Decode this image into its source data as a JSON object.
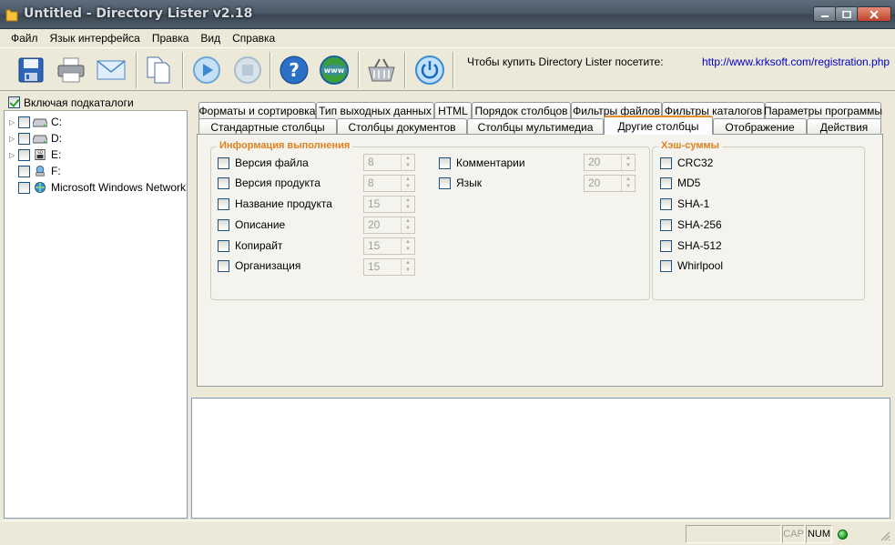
{
  "window": {
    "title": "Untitled - Directory Lister v2.18"
  },
  "menu": [
    "Файл",
    "Язык интерфейса",
    "Правка",
    "Вид",
    "Справка"
  ],
  "toolbar": {
    "buttons": [
      "save-icon",
      "print-icon",
      "mail-icon",
      "copy-icon",
      "play-icon",
      "stop-icon",
      "help-icon",
      "web-icon",
      "basket-icon",
      "power-icon"
    ],
    "buy_text": "Чтобы купить Directory Lister посетите:",
    "buy_link": "http://www.krksoft.com/registration.php"
  },
  "tree": {
    "include_subdirs": "Включая подкаталоги",
    "items": [
      {
        "label": "C:",
        "icon": "drive-icon"
      },
      {
        "label": "D:",
        "icon": "drive-icon"
      },
      {
        "label": "E:",
        "icon": "disk-icon"
      },
      {
        "label": "F:",
        "icon": "network-drive-icon"
      },
      {
        "label": "Microsoft Windows Network",
        "icon": "network-icon"
      }
    ]
  },
  "tabs": {
    "row1": [
      "Форматы и сортировка",
      "Тип выходных данных",
      "HTML",
      "Порядок столбцов",
      "Фильтры файлов",
      "Фильтры каталогов",
      "Параметры программы"
    ],
    "row2": [
      "Стандартные столбцы",
      "Столбцы документов",
      "Столбцы мультимедиа",
      "Другие столбцы",
      "Отображение",
      "Действия"
    ],
    "active": "Другие столбцы"
  },
  "run_info": {
    "title": "Информация выполнения",
    "left": [
      {
        "label": "Версия файла",
        "value": "8"
      },
      {
        "label": "Версия продукта",
        "value": "8"
      },
      {
        "label": "Название продукта",
        "value": "15"
      },
      {
        "label": "Описание",
        "value": "20"
      },
      {
        "label": "Копирайт",
        "value": "15"
      },
      {
        "label": "Организация",
        "value": "15"
      }
    ],
    "right": [
      {
        "label": "Комментарии",
        "value": "20"
      },
      {
        "label": "Язык",
        "value": "20"
      }
    ]
  },
  "hashes": {
    "title": "Хэш-суммы",
    "items": [
      "CRC32",
      "MD5",
      "SHA-1",
      "SHA-256",
      "SHA-512",
      "Whirlpool"
    ]
  },
  "status": {
    "cap": "CAP",
    "num": "NUM"
  }
}
